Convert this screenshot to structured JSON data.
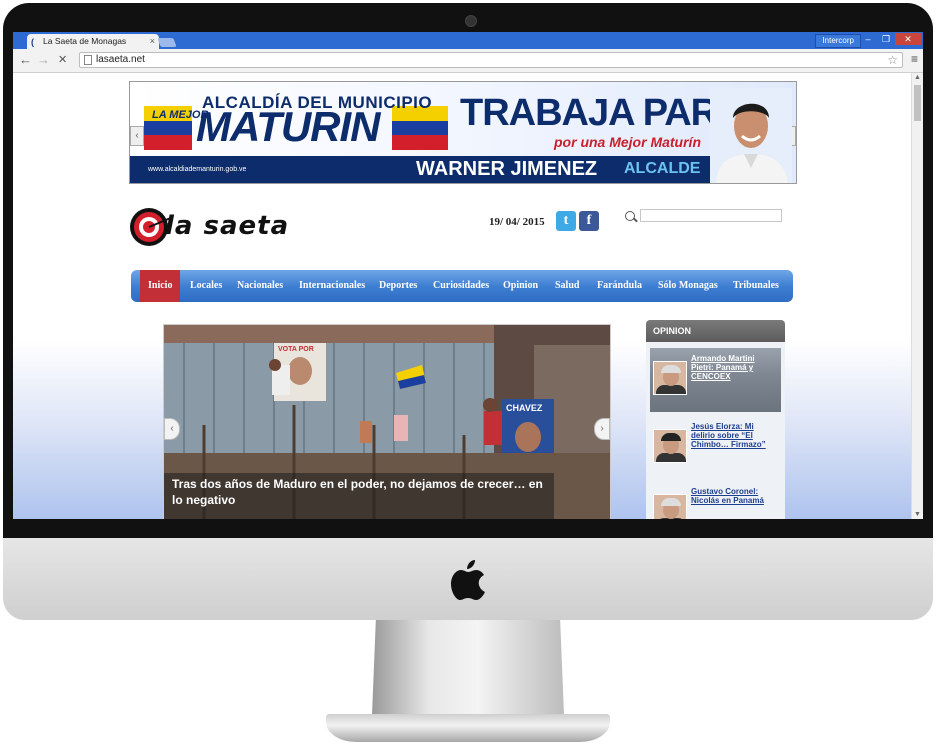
{
  "browser": {
    "tab_title": "La Saeta de Monagas",
    "tab_close": "×",
    "tab_favicon": "(",
    "profile_label": "Intercorp",
    "url": "lasaeta.net",
    "back_glyph": "←",
    "forward_glyph": "→",
    "stop_glyph": "✕",
    "star_glyph": "☆",
    "menu_glyph": "≡",
    "minimize_glyph": "–",
    "restore_glyph": "❐",
    "close_glyph": "✕"
  },
  "banner": {
    "heading": "ALCALDÍA DEL MUNICIPIO",
    "prefix": "LA MEJOR",
    "city": "MATURIN",
    "slogan": "TRABAJA PARA TI",
    "subslogan": "por una Mejor Maturín",
    "url": "www.alcaldiademanturin.gob.ve",
    "name": "WARNER JIMENEZ",
    "role": "ALCALDE",
    "flag_colors": [
      "#f5d000",
      "#1a3fa0",
      "#d21f2b"
    ]
  },
  "site": {
    "logo_text": "la saeta",
    "date": "19/ 04/ 2015",
    "twitter_glyph": "t",
    "facebook_glyph": "f",
    "accent_color": "#c32f36",
    "nav_color": "#3f7fd2"
  },
  "nav": {
    "items": [
      {
        "label": "Inicio",
        "active": true
      },
      {
        "label": "Locales"
      },
      {
        "label": "Nacionales"
      },
      {
        "label": "Internacionales"
      },
      {
        "label": "Deportes"
      },
      {
        "label": "Curiosidades"
      },
      {
        "label": "Opinion"
      },
      {
        "label": "Salud"
      },
      {
        "label": "Farándula"
      },
      {
        "label": "Sólo Monagas"
      },
      {
        "label": "Tribunales"
      }
    ]
  },
  "slider": {
    "caption": "Tras dos años de Maduro en el poder, no dejamos de crecer… en lo negativo",
    "prev_glyph": "‹",
    "next_glyph": "›",
    "poster_text": "VOTA POR",
    "banner_text": "CHAVEZ"
  },
  "opinion": {
    "heading": "OPINION",
    "items": [
      {
        "title": "Armando Martini Pietri: Panamá y CENCOEX"
      },
      {
        "title": "Jesús Elorza: Mi delirio sobre “El Chimbo… Firmazo”"
      },
      {
        "title": "Gustavo Coronel: Nicolás en Panamá"
      }
    ]
  }
}
